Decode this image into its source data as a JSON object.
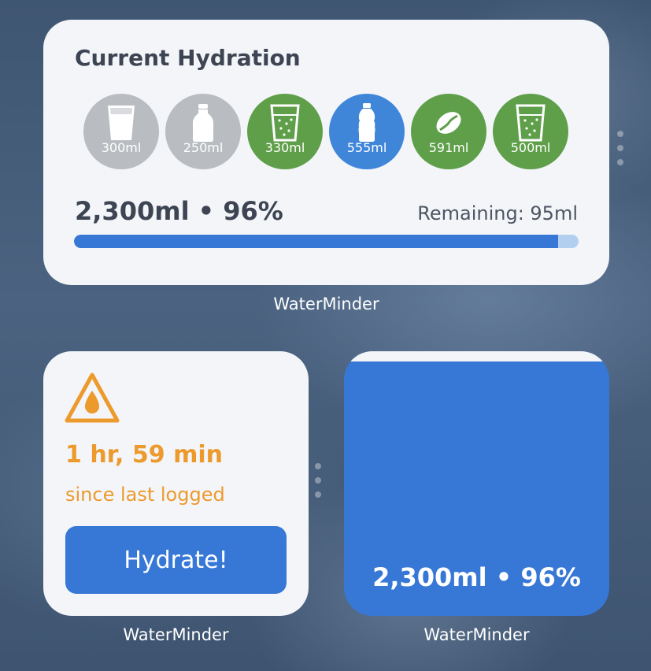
{
  "large_widget": {
    "title": "Current Hydration",
    "drinks": [
      {
        "amount": "300ml",
        "icon": "water-glass-icon",
        "color": "#b9bcc1"
      },
      {
        "amount": "250ml",
        "icon": "milk-bottle-icon",
        "color": "#b9bcc1"
      },
      {
        "amount": "330ml",
        "icon": "sparkling-glass-icon",
        "color": "#5f9f4a"
      },
      {
        "amount": "555ml",
        "icon": "water-bottle-icon",
        "color": "#3f86d9"
      },
      {
        "amount": "591ml",
        "icon": "coffee-bean-icon",
        "color": "#5f9f4a"
      },
      {
        "amount": "500ml",
        "icon": "sparkling-glass-icon",
        "color": "#5f9f4a"
      }
    ],
    "total": "2,300ml • 96%",
    "remaining": "Remaining: 95ml",
    "progress_fraction": 0.96,
    "app_label": "WaterMinder"
  },
  "alert_widget": {
    "icon": "water-warning-icon",
    "since_time": "1 hr, 59 min",
    "since_label": "since last logged",
    "button_label": "Hydrate!",
    "app_label": "WaterMinder"
  },
  "level_widget": {
    "total": "2,300ml • 96%",
    "fill_fraction": 0.96,
    "app_label": "WaterMinder"
  },
  "colors": {
    "accent_blue": "#3777d6",
    "warning_orange": "#ec9a2c",
    "drink_green": "#5f9f4a",
    "drink_gray": "#b9bcc1",
    "text_dark": "#3d4452",
    "widget_bg": "#f3f5f9"
  }
}
